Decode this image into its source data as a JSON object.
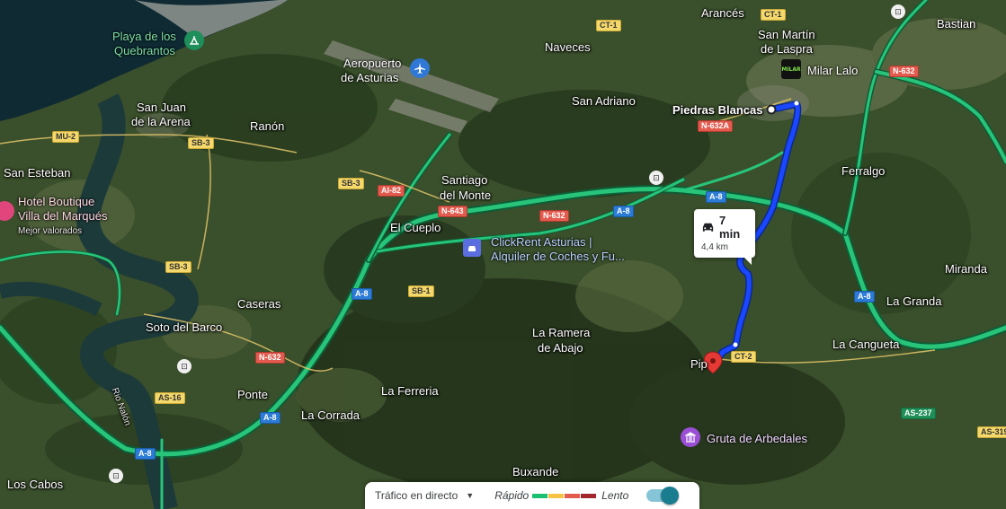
{
  "places": {
    "arances": "Arancés",
    "san_martin": "San Martín",
    "de_laspra": "de Laspra",
    "bastian": "Bastian",
    "naveces": "Naveces",
    "san_adriano": "San Adriano",
    "piedras_blancas": "Piedras Blancas",
    "ferralgo": "Ferralgo",
    "san_juan": "San Juan",
    "de_la_arena": "de la Arena",
    "ranon": "Ranón",
    "san_esteban": "San Esteban",
    "santiago": "Santiago",
    "del_monte": "del Monte",
    "el_cueplo": "El Cueplo",
    "caseras": "Caseras",
    "soto_del_barco": "Soto del Barco",
    "la_ramera": "La Ramera",
    "de_abajo": "de Abajo",
    "miranda": "Miranda",
    "la_granda": "La Granda",
    "la_cangueta": "La Cangueta",
    "ponte": "Ponte",
    "la_ferreria": "La Ferreria",
    "la_corrada": "La Corrada",
    "rio_nalon": "Rio Nalón",
    "buxande": "Buxande",
    "los_cabos": "Los Cabos",
    "pipa": "Pip"
  },
  "pois": {
    "playa_line1": "Playa de los",
    "playa_line2": "Quebrantos",
    "airport_line1": "Aeropuerto",
    "airport_line2": "de Asturias",
    "milar": "Milar Lalo",
    "hotel_line1": "Hotel Boutique",
    "hotel_line2": "Villa del Marqués",
    "hotel_sub": "Mejor valorados",
    "clickrent_line1": "ClickRent Asturias |",
    "clickrent_line2": "Alquiler de Coches y Fu...",
    "gruta": "Gruta de Arbedales",
    "milar_icon_text": "MILAR"
  },
  "roads": {
    "ct1": "CT-1",
    "n632_a": "N-632",
    "n632a": "N-632A",
    "mu2": "MU-2",
    "sb3_a": "SB-3",
    "sb3_b": "SB-3",
    "sb3_c": "SB-3",
    "ai82": "AI-82",
    "n643": "N-643",
    "n632_b": "N-632",
    "a8_a": "A-8",
    "a8_b": "A-8",
    "sb1": "SB-1",
    "a8_c": "A-8",
    "n632_c": "N-632",
    "a8_d": "A-8",
    "ct2": "CT-2",
    "as16": "AS-16",
    "a8_e": "A-8",
    "a8_f": "A-8",
    "as237": "AS-237",
    "as319": "AS-319",
    "ct1_b": "CT-1"
  },
  "route": {
    "duration": "7 min",
    "distance": "4,4 km",
    "color": "#1a47ff"
  },
  "traffic": {
    "live_label": "Tráfico en directo",
    "fast_label": "Rápido",
    "slow_label": "Lento",
    "colors": [
      "#1dbf73",
      "#f6c344",
      "#e35b4f",
      "#a3262a"
    ],
    "toggle_on": true
  }
}
